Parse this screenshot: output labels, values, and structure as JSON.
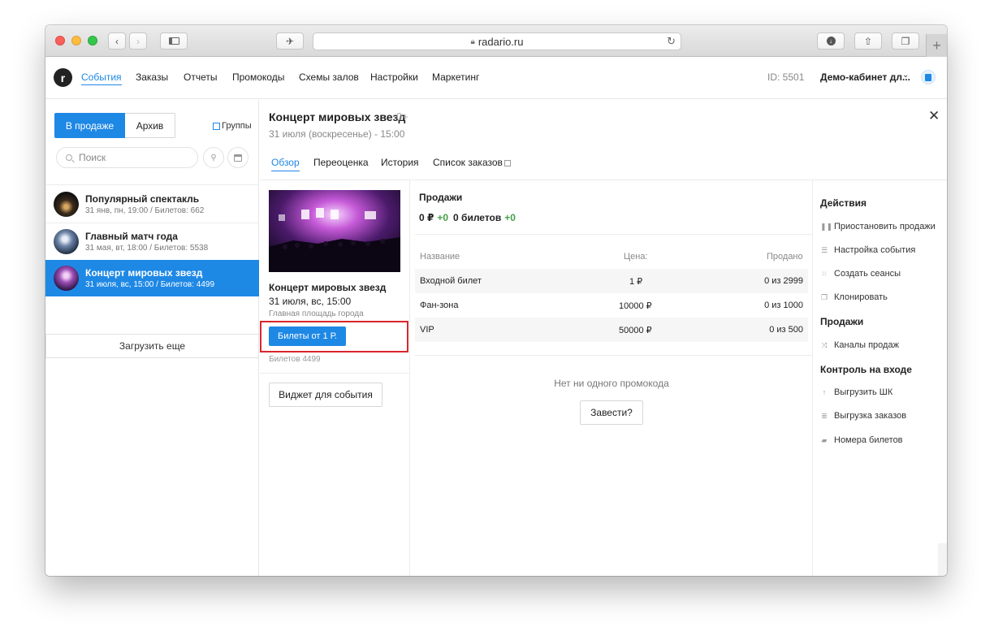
{
  "browser": {
    "url": "radario.ru",
    "new_tab": "+"
  },
  "nav": {
    "logo": "r",
    "items": [
      "События",
      "Заказы",
      "Отчеты",
      "Промокоды",
      "Схемы залов",
      "Настройки",
      "Маркетинг"
    ],
    "active_index": 0,
    "id_text": "ID: 5501",
    "cabinet": "Демо-кабинет дл..."
  },
  "sidebar": {
    "tab_on_sale": "В продаже",
    "tab_archive": "Архив",
    "groups_label": "Группы",
    "search_placeholder": "Поиск",
    "events": [
      {
        "title": "Популярный спектакль",
        "meta": "31 янв, пн, 19:00 / Билетов: 662"
      },
      {
        "title": "Главный матч года",
        "meta": "31 мая, вт, 18:00 / Билетов: 5538"
      },
      {
        "title": "Концерт мировых звезд",
        "meta": "31 июля, вс, 15:00 / Билетов: 4499"
      }
    ],
    "active_event_index": 2,
    "load_more": "Загрузить еще"
  },
  "event": {
    "title": "Концерт мировых звезд",
    "age": "0+",
    "datetime": "31 июля (воскресенье) - 15:00",
    "tabs": [
      "Обзор",
      "Переоценка",
      "История",
      "Список заказов"
    ],
    "active_tab_index": 0,
    "card": {
      "title": "Концерт мировых звезд",
      "date": "31 июля, вс, 15:00",
      "venue": "Главная площадь города",
      "ticket_button": "Билеты от 1 Р.",
      "tickets_count": "Билетов 4499",
      "widget_button": "Виджет для события"
    }
  },
  "sales": {
    "label": "Продажи",
    "amount": "0 ₽",
    "amount_delta": "+0",
    "tickets": "0 билетов",
    "tickets_delta": "+0",
    "columns": [
      "Название",
      "Цена:",
      "Продано"
    ],
    "rows": [
      {
        "name": "Входной билет",
        "price": "1 ₽",
        "sold": "0 из 2999"
      },
      {
        "name": "Фан-зона",
        "price": "10000 ₽",
        "sold": "0 из 1000"
      },
      {
        "name": "VIP",
        "price": "50000 ₽",
        "sold": "0 из 500"
      }
    ],
    "no_promo": "Нет ни одного промокода",
    "promo_button": "Завести?"
  },
  "actions": {
    "heading_actions": "Действия",
    "pause": "Приостановить продажи",
    "settings": "Настройка события",
    "sessions": "Создать сеансы",
    "clone": "Клонировать",
    "heading_sales": "Продажи",
    "channels": "Каналы продаж",
    "heading_control": "Контроль на входе",
    "export_barcodes": "Выгрузить ШК",
    "export_orders": "Выгрузка заказов",
    "ticket_numbers": "Номера билетов"
  },
  "colors": {
    "accent": "#1e88e5",
    "positive": "#43a047",
    "highlight_box": "#d8262c"
  }
}
